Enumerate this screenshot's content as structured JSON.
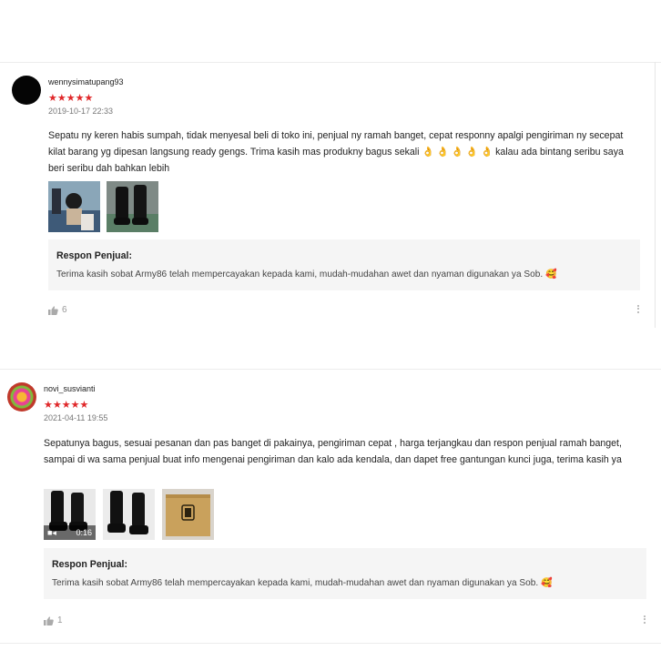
{
  "reviews": [
    {
      "username": "wennysimatupang93",
      "stars": "★★★★★",
      "date": "2019-10-17 22:33",
      "text_before_emoji": "Sepatu ny keren habis sumpah,  tidak menyesal beli di toko ini,  penjual ny ramah banget,  cepat responny apalgi pengiriman ny secepat kilat barang yg dipesan langsung ready gengs. Trima kasih mas produkny bagus sekali ",
      "emoji": "👌 👌 👌 👌 👌",
      "text_after_emoji": " kalau ada bintang seribu  saya beri seribu dah bahkan lebih",
      "seller_title": "Respon Penjual:",
      "seller_text": "Terima kasih sobat Army86 telah mempercayakan kepada kami, mudah-mudahan awet dan nyaman digunakan ya Sob.",
      "seller_emoji": "🥰",
      "likes": "6"
    },
    {
      "username": "novi_susvianti",
      "stars": "★★★★★",
      "date": "2021-04-11 19:55",
      "text": "Sepatunya bagus, sesuai pesanan dan pas banget di pakainya, pengiriman cepat , harga terjangkau dan respon penjual ramah banget, sampai di wa sama penjual buat info mengenai pengiriman dan kalo ada kendala, dan dapet free gantungan kunci juga, terima kasih ya",
      "video_duration": "0:16",
      "seller_title": "Respon Penjual:",
      "seller_text": "Terima kasih sobat Army86 telah mempercayakan kepada kami, mudah-mudahan awet dan nyaman digunakan ya Sob.",
      "seller_emoji": "🥰",
      "likes": "1"
    }
  ],
  "icons": {
    "like": "thumbs-up-icon",
    "more": "more-vertical-icon",
    "video": "video-camera-icon"
  },
  "colors": {
    "star": "#e0282a",
    "seller_bg": "#f5f5f5"
  }
}
